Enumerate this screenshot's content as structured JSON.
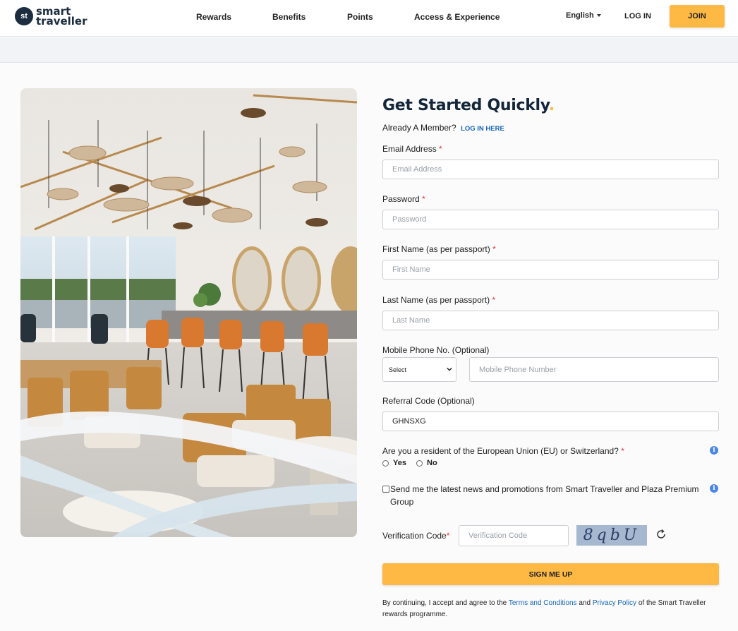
{
  "header": {
    "logo_text_1": "smart",
    "logo_text_2": "traveller",
    "logo_badge": "st",
    "nav": [
      "Rewards",
      "Benefits",
      "Points",
      "Access & Experience"
    ],
    "language": "English",
    "login": "LOG IN",
    "join": "JOIN"
  },
  "form": {
    "title": "Get Started Quickly",
    "title_dot": ".",
    "member_prompt": "Already A Member?",
    "member_link": "LOG IN HERE",
    "email": {
      "label": "Email Address",
      "placeholder": "Email Address"
    },
    "password": {
      "label": "Password",
      "placeholder": "Password"
    },
    "first_name": {
      "label": "First Name (as per passport)",
      "placeholder": "First Name"
    },
    "last_name": {
      "label": "Last Name (as per passport)",
      "placeholder": "Last Name"
    },
    "mobile": {
      "label": "Mobile Phone No. (Optional)",
      "select_value": "Select",
      "placeholder": "Mobile Phone Number"
    },
    "referral": {
      "label": "Referral Code (Optional)",
      "value": "GHNSXG"
    },
    "eu": {
      "question": "Are you a resident of the European Union (EU) or Switzerland?",
      "yes": "Yes",
      "no": "No"
    },
    "news": "Send me the latest news and promotions from Smart Traveller and Plaza Premium Group",
    "verification": {
      "label": "Verification Code",
      "placeholder": "Verification Code",
      "captcha": "8qbU"
    },
    "required_mark": "*",
    "info_glyph": "i",
    "submit": "SIGN ME UP",
    "terms": {
      "before": "By continuing, I accept and agree to the",
      "terms_link": "Terms and Conditions",
      "and": "and",
      "privacy_link": "Privacy Policy",
      "after": "of the Smart Traveller rewards programme."
    }
  },
  "colors": {
    "accent": "#fdb944",
    "link": "#1565c0",
    "brand_dark": "#13263a"
  },
  "icons": [
    "chevron-down-icon",
    "info-icon",
    "refresh-icon"
  ]
}
